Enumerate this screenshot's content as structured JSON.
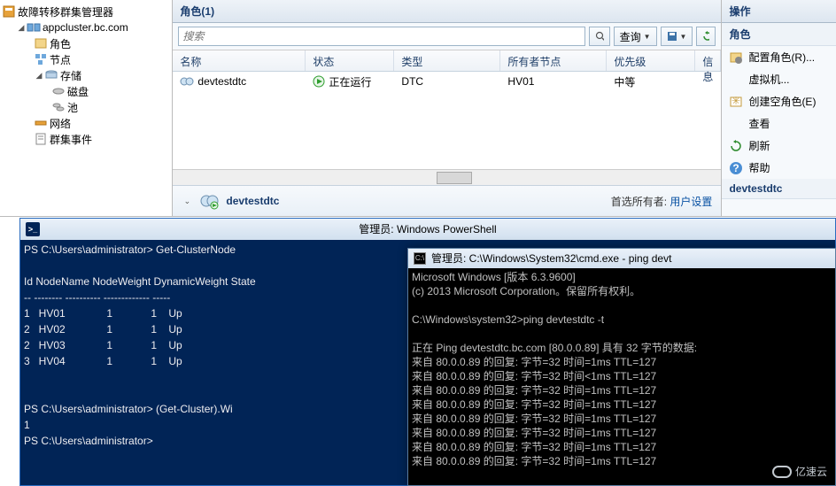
{
  "tree": {
    "root": "故障转移群集管理器",
    "cluster": "appcluster.bc.com",
    "roles": "角色",
    "nodes": "节点",
    "storage": "存储",
    "disk": "磁盘",
    "pool": "池",
    "network": "网络",
    "events": "群集事件"
  },
  "center": {
    "header": "角色(1)",
    "search_placeholder": "搜索",
    "query_label": "查询",
    "cols": {
      "name": "名称",
      "state": "状态",
      "type": "类型",
      "owner": "所有者节点",
      "priority": "优先级",
      "info": "信息"
    },
    "row": {
      "name": "devtestdtc",
      "state": "正在运行",
      "type": "DTC",
      "owner": "HV01",
      "priority": "中等",
      "info": ""
    },
    "detail_name": "devtestdtc",
    "pref_owner_label": "首选所有者:",
    "pref_owner_value": "用户设置"
  },
  "actions": {
    "title": "操作",
    "sub": "角色",
    "items": [
      "配置角色(R)...",
      "虚拟机...",
      "创建空角色(E)",
      "查看",
      "刷新",
      "帮助"
    ],
    "context_header": "devtestdtc"
  },
  "powershell": {
    "title": "管理员: Windows PowerShell",
    "prompt": "PS C:\\Users\\administrator>",
    "cmd1": "Get-ClusterNode",
    "header": "Id NodeName NodeWeight DynamicWeight State",
    "divider": "-- -------- ---------- ------------- -----",
    "rows": [
      {
        "id": "1",
        "name": "HV01",
        "nw": "1",
        "dw": "1",
        "state": "Up"
      },
      {
        "id": "2",
        "name": "HV02",
        "nw": "1",
        "dw": "1",
        "state": "Up"
      },
      {
        "id": "2",
        "name": "HV03",
        "nw": "1",
        "dw": "1",
        "state": "Up"
      },
      {
        "id": "3",
        "name": "HV04",
        "nw": "1",
        "dw": "1",
        "state": "Up"
      }
    ],
    "cmd2": "(Get-Cluster).Wi",
    "out2": "1"
  },
  "cmd": {
    "title": "管理员: C:\\Windows\\System32\\cmd.exe - ping  devt",
    "l1": "Microsoft Windows [版本 6.3.9600]",
    "l2": "(c) 2013 Microsoft Corporation。保留所有权利。",
    "l3": "C:\\Windows\\system32>ping devtestdtc -t",
    "l4": "正在 Ping devtestdtc.bc.com [80.0.0.89] 具有 32 字节的数据:",
    "replies": [
      "来自 80.0.0.89 的回复: 字节=32 时间=1ms TTL=127",
      "来自 80.0.0.89 的回复: 字节=32 时间<1ms TTL=127",
      "来自 80.0.0.89 的回复: 字节=32 时间=1ms TTL=127",
      "来自 80.0.0.89 的回复: 字节=32 时间=1ms TTL=127",
      "来自 80.0.0.89 的回复: 字节=32 时间=1ms TTL=127",
      "来自 80.0.0.89 的回复: 字节=32 时间=1ms TTL=127",
      "来自 80.0.0.89 的回复: 字节=32 时间=1ms TTL=127",
      "来自 80.0.0.89 的回复: 字节=32 时间=1ms TTL=127"
    ]
  },
  "watermark": "亿速云"
}
